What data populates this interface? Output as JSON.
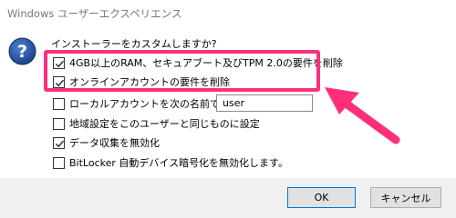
{
  "window": {
    "title": "Windows ユーザーエクスペリエンス"
  },
  "dialog": {
    "question": "インストーラーをカスタムしますか?",
    "options": [
      {
        "label": "4GB以上のRAM、セキュアブート及びTPM 2.0の要件を削除",
        "checked": true
      },
      {
        "label": "オンラインアカウントの要件を削除",
        "checked": true
      },
      {
        "label": "ローカルアカウントを次の名前で作成:",
        "checked": false
      },
      {
        "label": "地域設定をこのユーザーと同じものに設定",
        "checked": false
      },
      {
        "label": "データ収集を無効化",
        "checked": true
      },
      {
        "label": "BitLocker 自動デバイス暗号化を無効化します。",
        "checked": false
      }
    ],
    "username_value": "user"
  },
  "buttons": {
    "ok": "OK",
    "cancel": "キャンセル"
  },
  "colors": {
    "highlight": "#ff2f7c",
    "icon_blue": "#1f4e9a"
  }
}
